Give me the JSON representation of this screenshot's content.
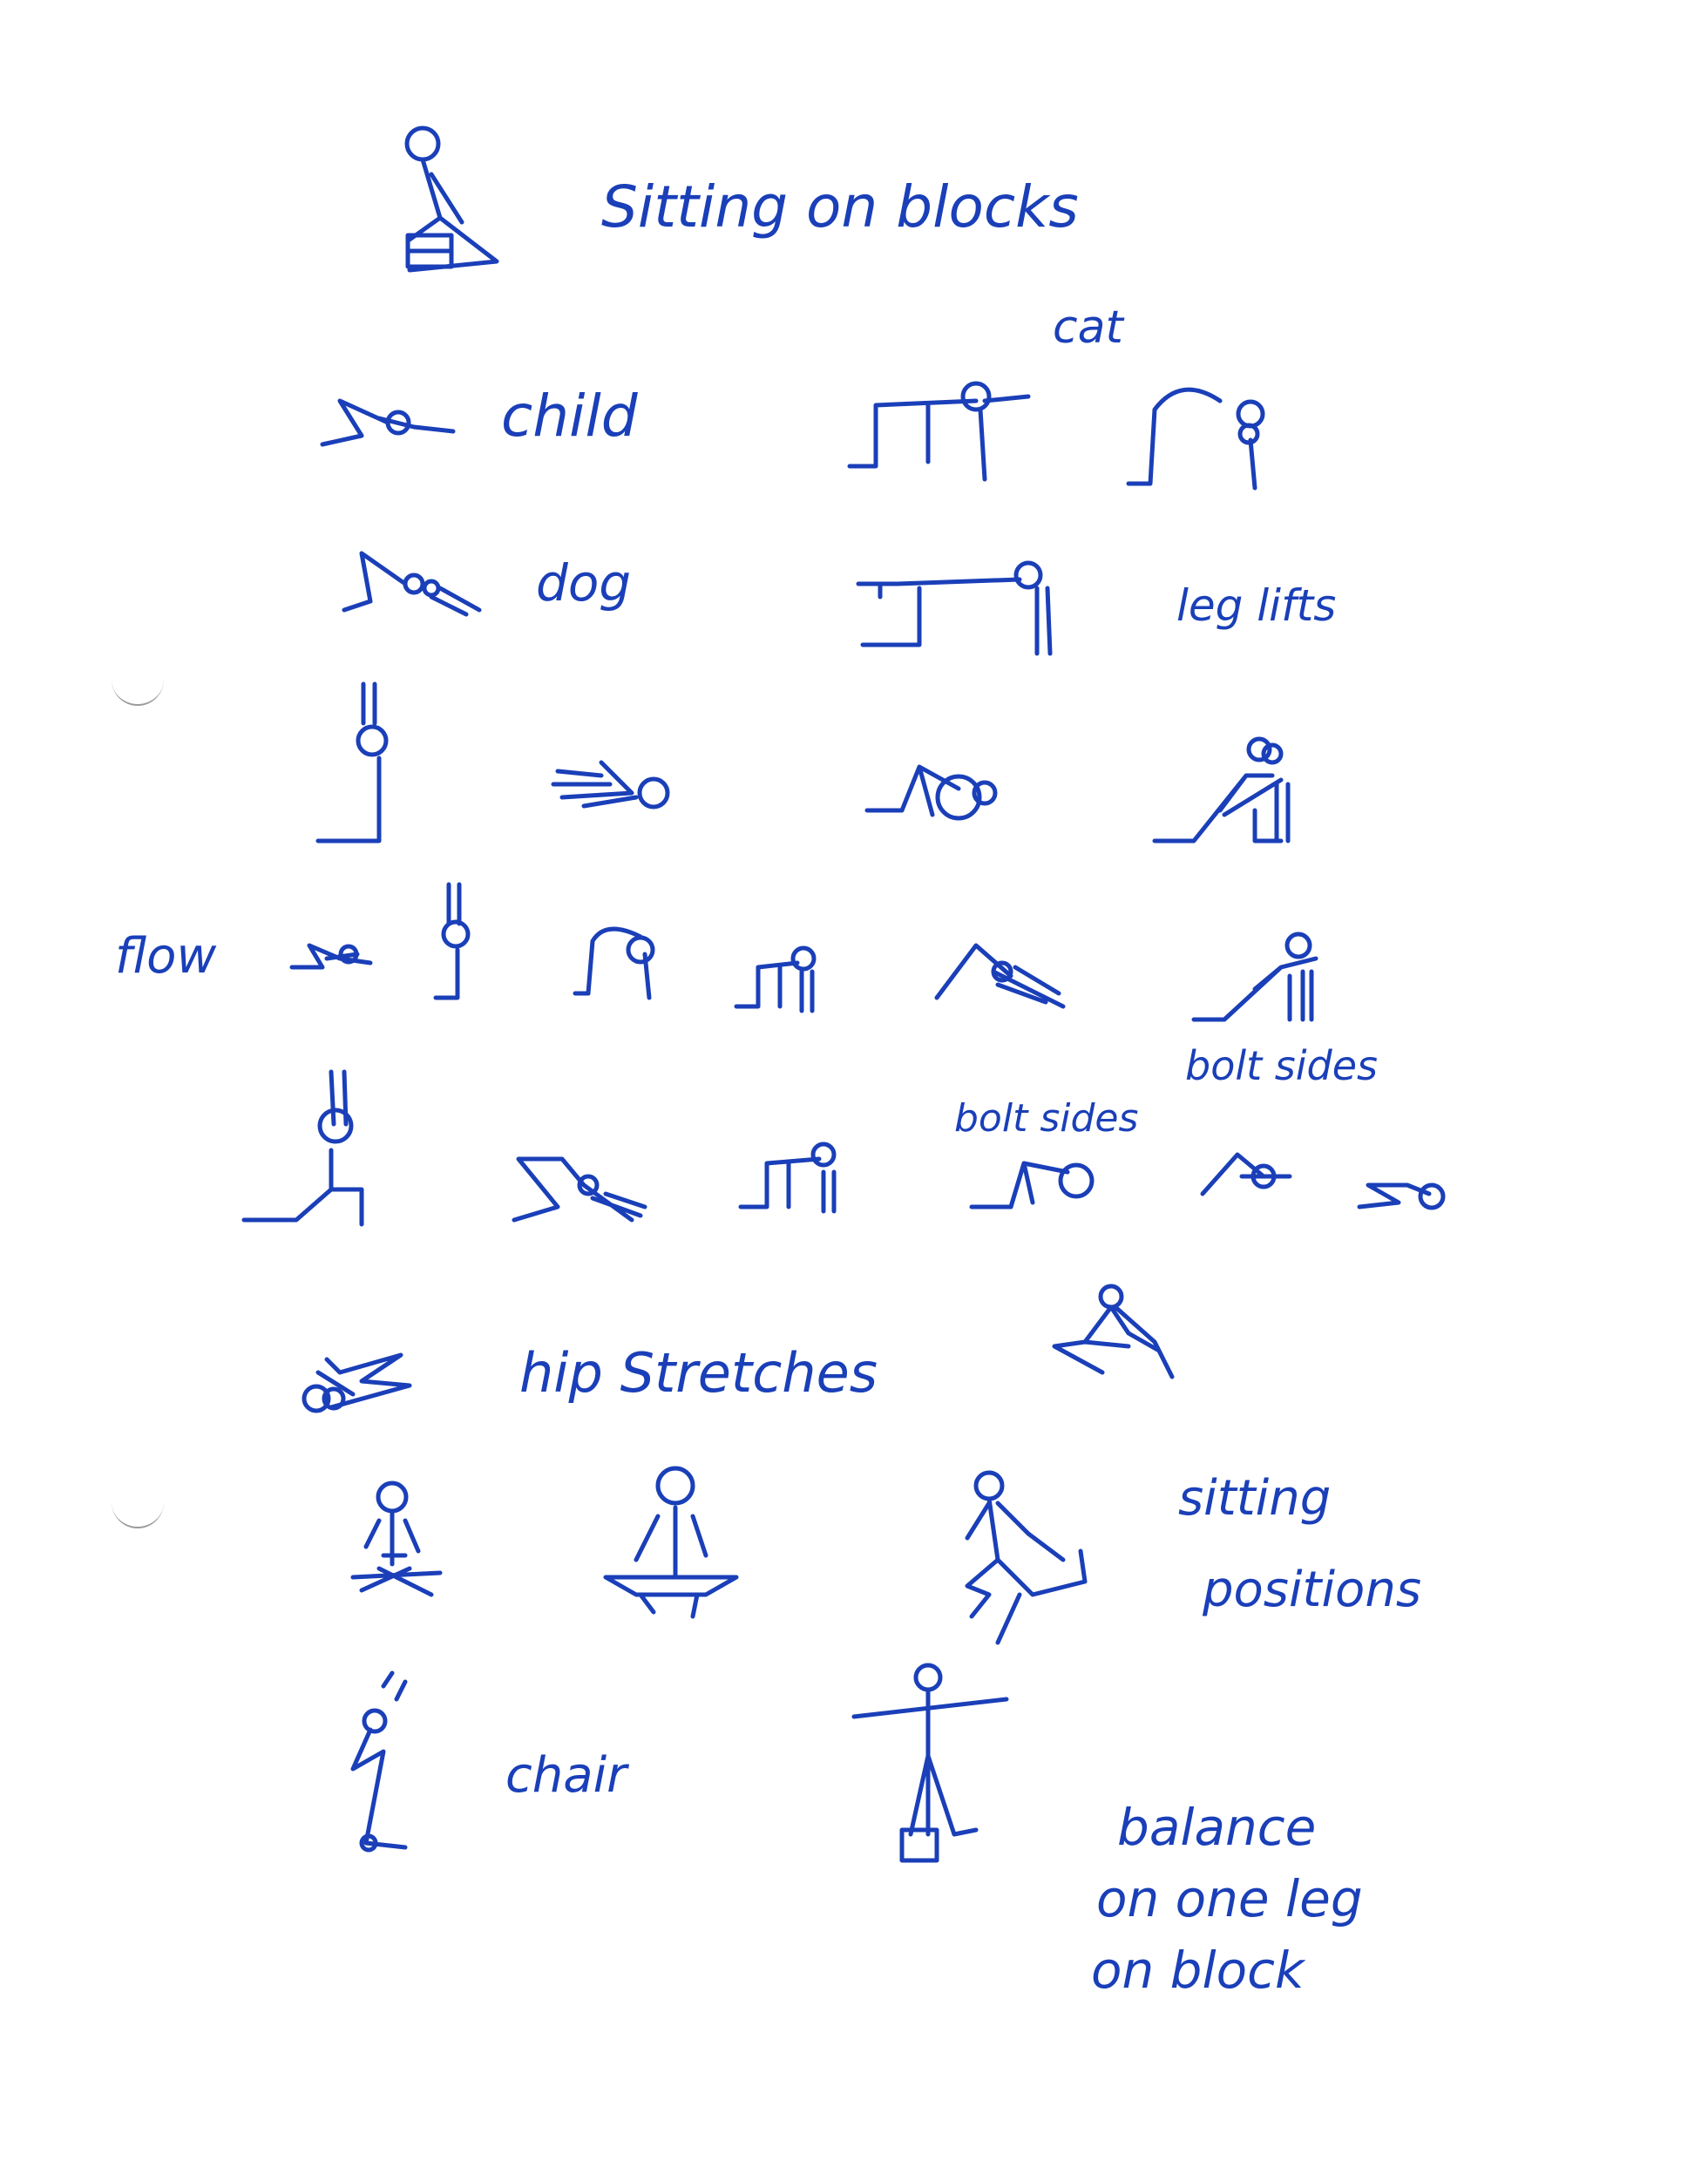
{
  "labels": {
    "sitting_on_blocks": "Sitting on blocks",
    "cat": "cat",
    "child": "child",
    "dog": "dog",
    "leg_lifts": "leg lifts",
    "flow": "flow",
    "bolt_sides_1": "bolt sides",
    "bolt_sides_2": "bolt sides",
    "hip_stretches": "hip Stretches",
    "sitting_positions_line1": "sitting",
    "sitting_positions_line2": "positions",
    "chair": "chair",
    "balance_line1": "balance",
    "balance_line2": "on one leg",
    "balance_line3": "on block"
  },
  "colors": {
    "ink": "#1a3fb8",
    "paper": "#ffffff"
  }
}
